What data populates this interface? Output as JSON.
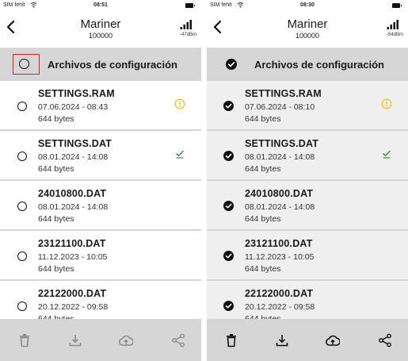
{
  "colors": {
    "warning": "#f0c419",
    "success": "#2e9a2e",
    "highlight_border": "#e02020",
    "enabled_icon": "#111111",
    "disabled_icon": "#8c8c8c"
  },
  "phones": [
    {
      "status": {
        "carrier": "SIM fehlt",
        "time": "08:51"
      },
      "nav": {
        "title": "Mariner",
        "subtitle": "100000",
        "signal": "-47dBm"
      },
      "header": {
        "label": "Archivos de configuración",
        "all_selected": false,
        "highlighted": true
      },
      "files": [
        {
          "name": "SETTINGS.RAM",
          "date": "07.06.2024 - 08:43",
          "size": "644 bytes",
          "status_icon": "warning-icon",
          "selected": false
        },
        {
          "name": "SETTINGS.DAT",
          "date": "08.01.2024 - 14:08",
          "size": "644 bytes",
          "status_icon": "synced-check-icon",
          "selected": false
        },
        {
          "name": "24010800.DAT",
          "date": "08.01.2024 - 14:08",
          "size": "644 bytes",
          "status_icon": "",
          "selected": false
        },
        {
          "name": "23121100.DAT",
          "date": "11.12.2023 - 10:05",
          "size": "644 bytes",
          "status_icon": "",
          "selected": false
        },
        {
          "name": "22122000.DAT",
          "date": "20.12.2022 - 09:58",
          "size": "644 bytes",
          "status_icon": "",
          "selected": false
        }
      ],
      "toolbar": {
        "enabled": false,
        "icons": [
          "trash-icon",
          "download-icon",
          "cloud-upload-icon",
          "share-icon"
        ]
      }
    },
    {
      "status": {
        "carrier": "SIM fehlt",
        "time": "08:30"
      },
      "nav": {
        "title": "Mariner",
        "subtitle": "100000",
        "signal": "-54dBm"
      },
      "header": {
        "label": "Archivos de configuración",
        "all_selected": true,
        "highlighted": false
      },
      "files": [
        {
          "name": "SETTINGS.RAM",
          "date": "07.06.2024 - 08:10",
          "size": "644 bytes",
          "status_icon": "warning-icon",
          "selected": true
        },
        {
          "name": "SETTINGS.DAT",
          "date": "08.01.2024 - 14:08",
          "size": "644 bytes",
          "status_icon": "synced-check-icon",
          "selected": true
        },
        {
          "name": "24010800.DAT",
          "date": "08.01.2024 - 14:08",
          "size": "644 bytes",
          "status_icon": "",
          "selected": true
        },
        {
          "name": "23121100.DAT",
          "date": "11.12.2023 - 10:05",
          "size": "644 bytes",
          "status_icon": "",
          "selected": true
        },
        {
          "name": "22122000.DAT",
          "date": "20.12.2022 - 09:58",
          "size": "644 bytes",
          "status_icon": "",
          "selected": true
        }
      ],
      "toolbar": {
        "enabled": true,
        "icons": [
          "trash-icon",
          "download-icon",
          "cloud-upload-icon",
          "share-icon"
        ]
      }
    }
  ]
}
